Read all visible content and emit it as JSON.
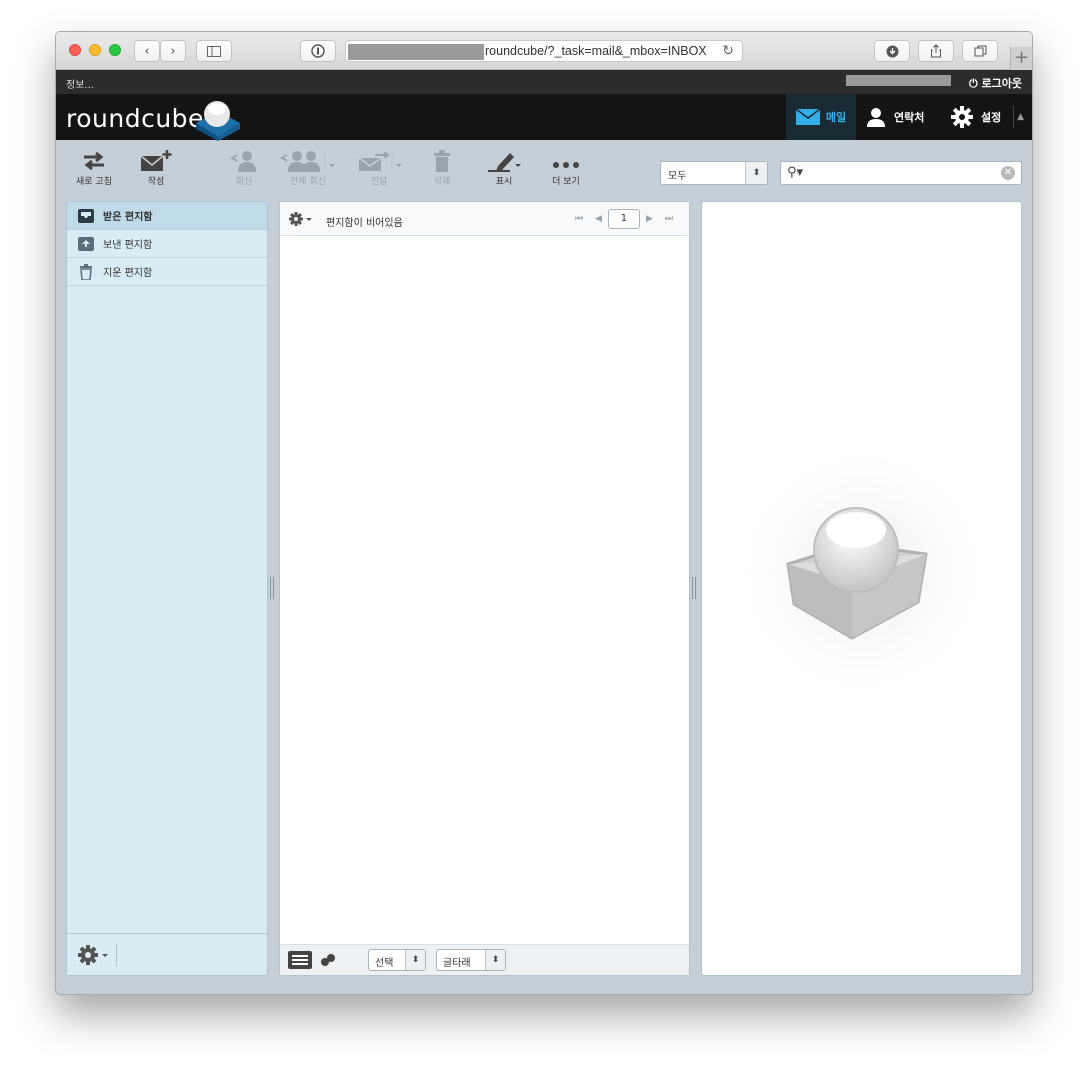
{
  "browser": {
    "url_visible": "roundcube/?_task=mail&_mbox=INBOX"
  },
  "topbar": {
    "info_link": "정보...",
    "logout_label": "로그아웃"
  },
  "header": {
    "logo_text": "roundcube",
    "nav": {
      "mail": "메일",
      "contacts": "연락처",
      "settings": "설정"
    }
  },
  "toolbar": {
    "refresh": "새로 고침",
    "compose": "작성",
    "reply": "회신",
    "reply_all": "전체 회신",
    "forward": "전달",
    "delete": "삭제",
    "mark": "표시",
    "more": "더 보기",
    "filter_selected": "모두",
    "search_value": ""
  },
  "folders": [
    {
      "label": "받은 편지함",
      "selected": true
    },
    {
      "label": "보낸 편지함",
      "selected": false
    },
    {
      "label": "지운 편지함",
      "selected": false
    }
  ],
  "message_list": {
    "status": "편지함이 비어있음",
    "page": "1",
    "footer_select": "선택",
    "footer_threads": "글타래"
  },
  "colors": {
    "accent": "#35aee8",
    "header_bg": "#141414",
    "folder_bg": "#d9ecf4"
  }
}
